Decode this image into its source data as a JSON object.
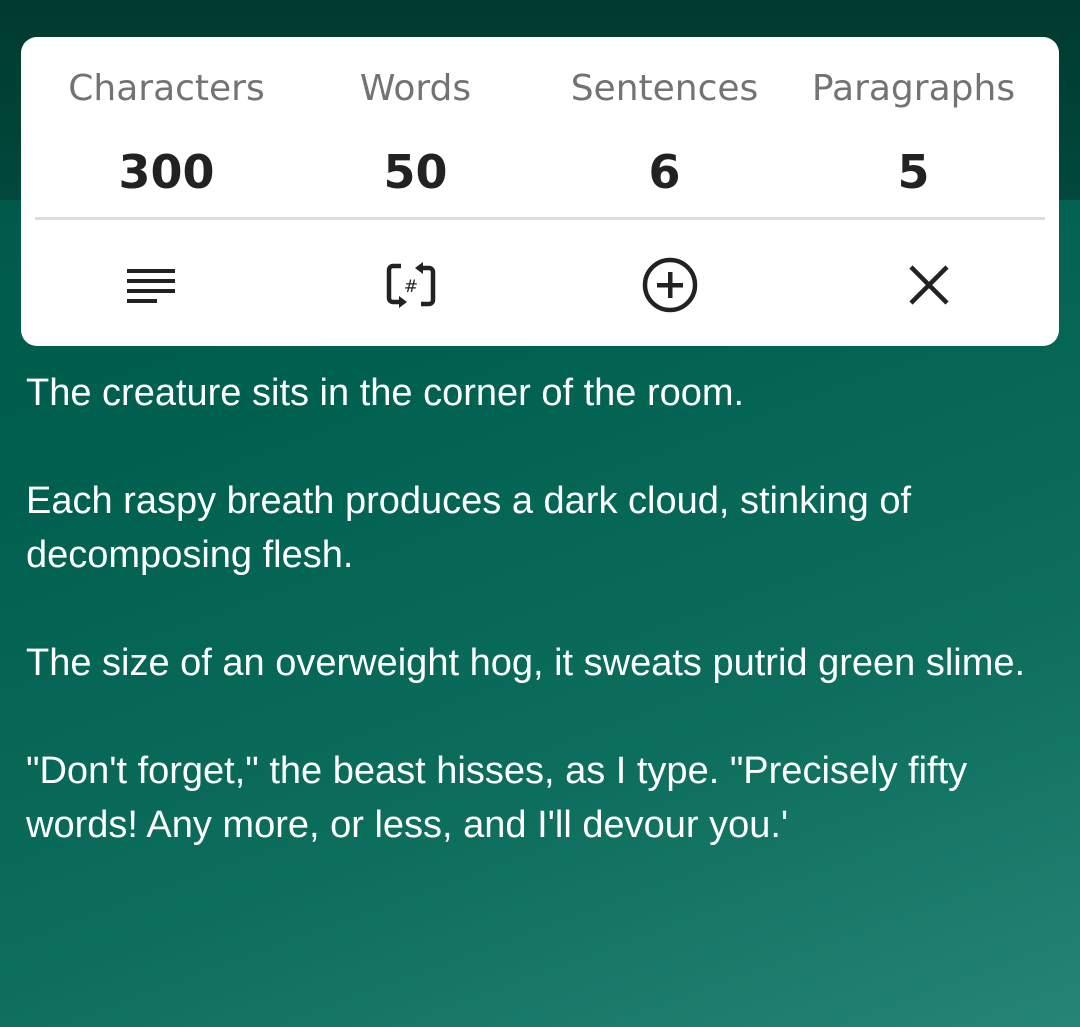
{
  "stats": [
    {
      "label": "Characters",
      "value": "300"
    },
    {
      "label": "Words",
      "value": "50"
    },
    {
      "label": "Sentences",
      "value": "6"
    },
    {
      "label": "Paragraphs",
      "value": "5"
    }
  ],
  "actions": [
    {
      "icon": "text-lines-icon"
    },
    {
      "icon": "hash-refresh-icon",
      "glyph": "#"
    },
    {
      "icon": "add-circle-icon"
    },
    {
      "icon": "close-icon"
    }
  ],
  "colors": {
    "background_top": "#003a2f",
    "background_gradient_start": "#005646",
    "background_gradient_end": "#248576",
    "card": "#ffffff",
    "label": "#737373",
    "value": "#222222",
    "icon": "#222222",
    "story_text": "#ffffff"
  },
  "story": {
    "paragraphs": [
      "The creature sits in the corner of the room.",
      "Each raspy breath produces a dark cloud, stinking  of decomposing flesh.",
      "The size of an overweight hog, it sweats putrid green slime.",
      "\"Don't forget,\" the beast hisses, as I type. \"Precisely fifty words! Any more, or less, and I'll devour you.'"
    ]
  }
}
